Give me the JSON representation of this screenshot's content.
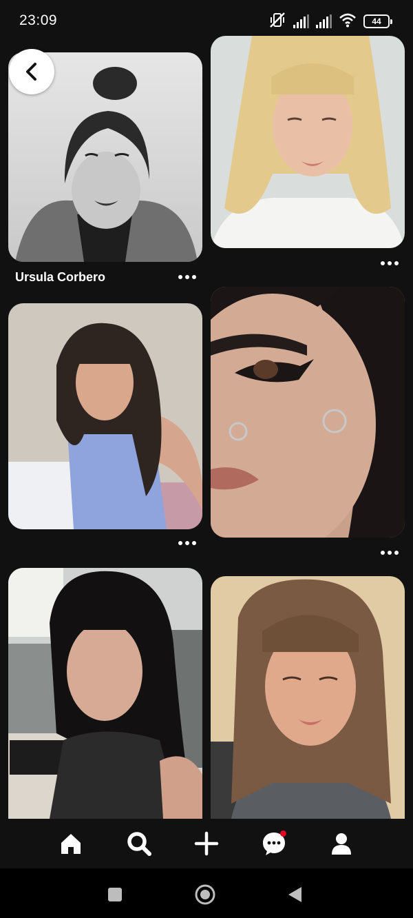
{
  "status_bar": {
    "time": "23:09",
    "battery": "44",
    "icons": [
      "muted-vibrate-icon",
      "signal-icon",
      "signal-icon",
      "wifi-icon",
      "battery-icon"
    ]
  },
  "pins": [
    {
      "title": "Ursula Corbero",
      "has_more": true
    },
    {
      "title": "",
      "has_more": true
    },
    {
      "title": "",
      "has_more": true
    },
    {
      "title": "",
      "has_more": true
    },
    {
      "title": "",
      "has_more": false
    },
    {
      "title": "",
      "has_more": false
    }
  ],
  "nav": {
    "items": [
      "home-icon",
      "search-icon",
      "create-icon",
      "messages-icon",
      "profile-icon"
    ],
    "active": "search-icon",
    "notification_color": "#e60023"
  },
  "system_nav": [
    "recents-button",
    "home-button",
    "back-button"
  ],
  "colors": {
    "background": "#111111",
    "text": "#ffffff",
    "accent": "#e60023"
  }
}
